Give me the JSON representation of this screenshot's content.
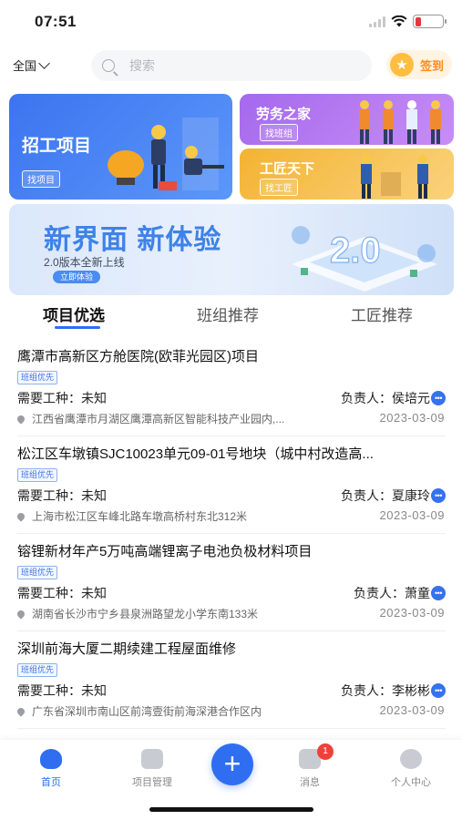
{
  "status_bar": {
    "time": "07:51"
  },
  "header": {
    "region": "全国",
    "search_placeholder": "搜索",
    "signin_label": "签到"
  },
  "banners": {
    "recruit": {
      "title": "招工项目",
      "tag": "找项目"
    },
    "labor": {
      "title": "劳务之家",
      "tag": "找班组"
    },
    "craft": {
      "title": "工匠天下",
      "tag": "找工匠"
    },
    "promo": {
      "title": "新界面 新体验",
      "subtitle": "2.0版本全新上线",
      "button": "立即体验"
    }
  },
  "tabs": [
    {
      "label": "项目优选",
      "active": true
    },
    {
      "label": "班组推荐",
      "active": false
    },
    {
      "label": "工匠推荐",
      "active": false
    }
  ],
  "projects": [
    {
      "title": "鹰潭市高新区方舱医院(欧菲光园区)项目",
      "badge": "班组优先",
      "trade": "需要工种：未知",
      "owner": "负责人：侯培元",
      "address": "江西省鹰潭市月湖区鹰潭高新区智能科技产业园内,...",
      "date": "2023-03-09"
    },
    {
      "title": "松江区车墩镇SJC10023单元09-01号地块（城中村改造高...",
      "badge": "班组优先",
      "trade": "需要工种：未知",
      "owner": "负责人：夏康玲",
      "address": "上海市松江区车峰北路车墩高桥村东北312米",
      "date": "2023-03-09"
    },
    {
      "title": "镕锂新材年产5万吨高端锂离子电池负极材料项目",
      "badge": "班组优先",
      "trade": "需要工种：未知",
      "owner": "负责人：萧童",
      "address": "湖南省长沙市宁乡县泉洲路望龙小学东南133米",
      "date": "2023-03-09"
    },
    {
      "title": "深圳前海大厦二期续建工程屋面维修",
      "badge": "班组优先",
      "trade": "需要工种：未知",
      "owner": "负责人：李彬彬",
      "address": "广东省深圳市南山区前湾壹街前海深港合作区内",
      "date": "2023-03-09"
    }
  ],
  "tabbar": {
    "home": "首页",
    "project_manage": "项目管理",
    "messages": "消息",
    "messages_badge": "1",
    "profile": "个人中心"
  },
  "colors": {
    "accent": "#2f6ef0",
    "signin": "#ff8c1a",
    "badge_red": "#f0403a"
  }
}
